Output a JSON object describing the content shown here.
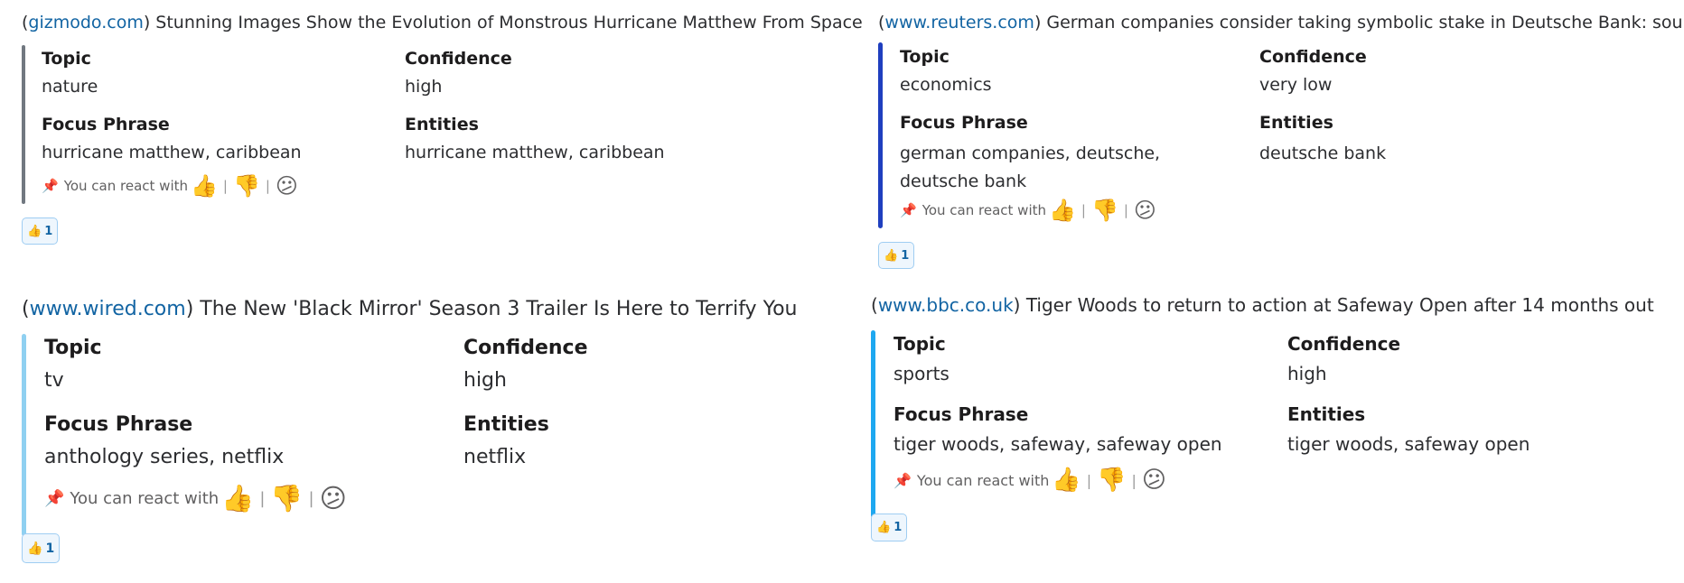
{
  "react_prompt": "You can react with",
  "icons": {
    "pin": "pushpin-icon",
    "thumbs_up": "thumbs-up-emoji",
    "thumbs_down": "thumbs-down-emoji",
    "confused": "confused-face-emoji"
  },
  "glyphs": {
    "pin": "📌",
    "thumbs_up": "👍",
    "thumbs_down": "👎",
    "confused": "😕",
    "separator": "|"
  },
  "labels": {
    "topic": "Topic",
    "confidence": "Confidence",
    "focus_phrase": "Focus Phrase",
    "entities": "Entities"
  },
  "colors": {
    "link": "#1264a3",
    "bar_gizmodo": "#717880",
    "bar_reuters": "#1f3fbf",
    "bar_wired": "#8fd0f1",
    "bar_bbc": "#1ea8f0"
  },
  "messages": [
    {
      "source": "gizmodo.com",
      "title": "Stunning Images Show the Evolution of Monstrous Hurricane Matthew From Space",
      "topic": "nature",
      "confidence": "high",
      "focus_phrase": "hurricane matthew, caribbean",
      "entities": "hurricane matthew, caribbean",
      "reaction_count": "1"
    },
    {
      "source": "www.reuters.com",
      "title": "German companies consider taking symbolic stake in Deutsche Bank: source",
      "topic": "economics",
      "confidence": "very low",
      "focus_phrase": "german companies, deutsche, deutsche bank",
      "entities": "deutsche bank",
      "reaction_count": "1"
    },
    {
      "source": "www.wired.com",
      "title": "The New 'Black Mirror' Season 3 Trailer Is Here to Terrify You",
      "topic": "tv",
      "confidence": "high",
      "focus_phrase": "anthology series, netflix",
      "entities": "netflix",
      "reaction_count": "1"
    },
    {
      "source": "www.bbc.co.uk",
      "title": "Tiger Woods to return to action at Safeway Open after 14 months out",
      "topic": "sports",
      "confidence": "high",
      "focus_phrase": "tiger woods, safeway, safeway open",
      "entities": "tiger woods, safeway open",
      "reaction_count": "1"
    }
  ]
}
